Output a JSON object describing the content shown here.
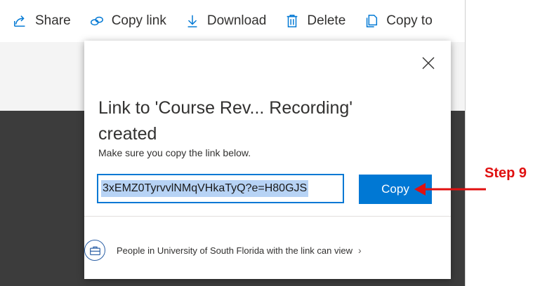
{
  "toolbar": {
    "items": [
      {
        "label": "Share",
        "icon": "share-icon"
      },
      {
        "label": "Copy link",
        "icon": "link-icon"
      },
      {
        "label": "Download",
        "icon": "download-icon"
      },
      {
        "label": "Delete",
        "icon": "trash-icon"
      },
      {
        "label": "Copy to",
        "icon": "copy-to-icon"
      }
    ]
  },
  "dialog": {
    "title": "Link to 'Course Rev... Recording' created",
    "subtitle": "Make sure you copy the link below.",
    "link_value": "3xEMZ0TyrvvlNMqVHkaTyQ?e=H80GJS",
    "copy_label": "Copy",
    "permission_text": "People in University of South Florida with the link can view",
    "permission_icon": "briefcase-icon",
    "close_icon": "close-icon"
  },
  "annotation": {
    "label": "Step 9",
    "color": "#e01010"
  },
  "colors": {
    "accent": "#0078d4",
    "selection": "#b7d3f5"
  }
}
